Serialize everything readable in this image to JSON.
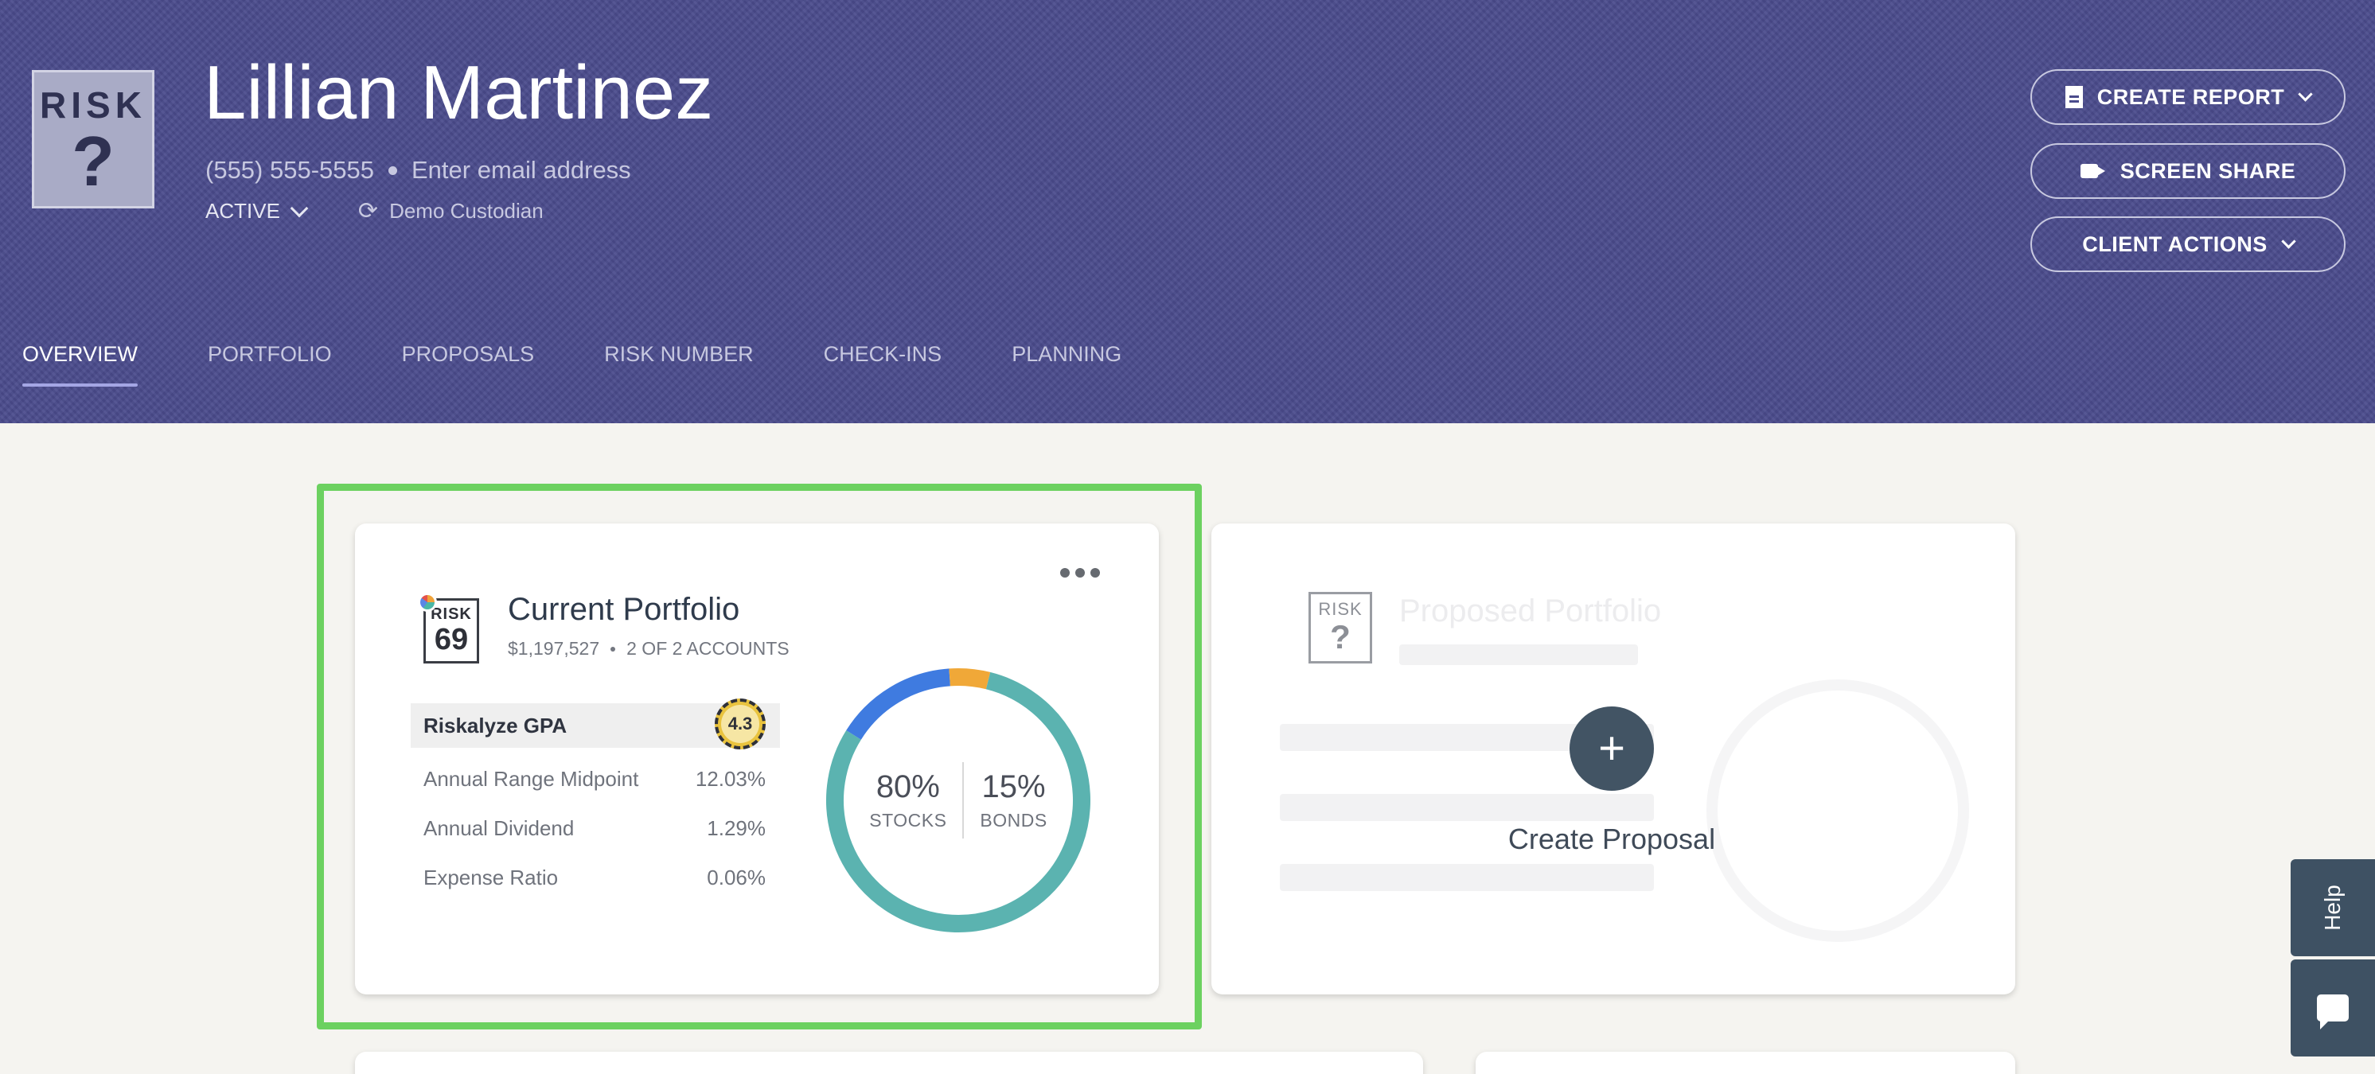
{
  "header": {
    "badge": {
      "word": "RISK",
      "symbol": "?"
    },
    "client_name": "Lillian Martinez",
    "phone": "(555) 555-5555",
    "email_placeholder": "Enter email address",
    "status": "ACTIVE",
    "custodian": "Demo Custodian",
    "buttons": {
      "create_report": "CREATE REPORT",
      "screen_share": "SCREEN SHARE",
      "client_actions": "CLIENT ACTIONS"
    }
  },
  "tabs": [
    {
      "label": "OVERVIEW",
      "active": true
    },
    {
      "label": "PORTFOLIO"
    },
    {
      "label": "PROPOSALS"
    },
    {
      "label": "RISK NUMBER"
    },
    {
      "label": "CHECK-INS"
    },
    {
      "label": "PLANNING"
    }
  ],
  "current_portfolio": {
    "risk_word": "RISK",
    "risk_number": "69",
    "title": "Current Portfolio",
    "value": "$1,197,527",
    "accounts": "2 OF 2 ACCOUNTS",
    "gpa_label": "Riskalyze GPA",
    "gpa_value": "4.3",
    "metrics": [
      {
        "label": "Annual Range Midpoint",
        "value": "12.03%"
      },
      {
        "label": "Annual Dividend",
        "value": "1.29%"
      },
      {
        "label": "Expense Ratio",
        "value": "0.06%"
      }
    ],
    "allocation": {
      "stocks_pct": "80%",
      "stocks_label": "STOCKS",
      "bonds_pct": "15%",
      "bonds_label": "BONDS",
      "segments": [
        {
          "name": "stocks-teal",
          "percent": 80,
          "color": "#5bb3b0"
        },
        {
          "name": "stocks-blue",
          "percent": 15,
          "color": "#3f7be0"
        },
        {
          "name": "other-orange",
          "percent": 5,
          "color": "#f0a838"
        }
      ]
    }
  },
  "proposed_portfolio": {
    "risk_word": "RISK",
    "risk_symbol": "?",
    "title": "Proposed Portfolio",
    "plus_symbol": "+",
    "create_label": "Create Proposal"
  },
  "support": {
    "help_label": "Help"
  },
  "colors": {
    "header_bg": "#4a4b8c",
    "highlight": "#6cd160",
    "button_dark": "#425464"
  }
}
